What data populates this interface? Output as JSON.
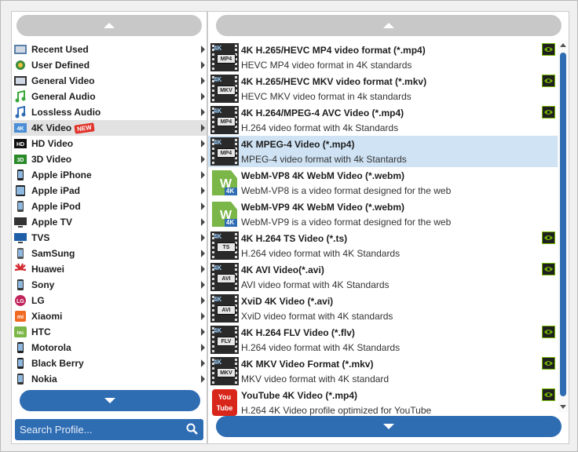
{
  "left_panel": {
    "categories": [
      {
        "label": "Recent Used",
        "icon": "recent-used-icon"
      },
      {
        "label": "User Defined",
        "icon": "user-defined-icon"
      },
      {
        "label": "General Video",
        "icon": "general-video-icon"
      },
      {
        "label": "General Audio",
        "icon": "general-audio-icon"
      },
      {
        "label": "Lossless Audio",
        "icon": "lossless-audio-icon"
      },
      {
        "label": "4K Video",
        "icon": "4k-video-icon",
        "badge": "NEW",
        "selected": true
      },
      {
        "label": "HD Video",
        "icon": "hd-video-icon"
      },
      {
        "label": "3D Video",
        "icon": "3d-video-icon"
      },
      {
        "label": "Apple iPhone",
        "icon": "iphone-icon"
      },
      {
        "label": "Apple iPad",
        "icon": "ipad-icon"
      },
      {
        "label": "Apple iPod",
        "icon": "ipod-icon"
      },
      {
        "label": "Apple TV",
        "icon": "apple-tv-icon"
      },
      {
        "label": "TVS",
        "icon": "tv-icon"
      },
      {
        "label": "SamSung",
        "icon": "samsung-icon"
      },
      {
        "label": "Huawei",
        "icon": "huawei-icon"
      },
      {
        "label": "Sony",
        "icon": "sony-icon"
      },
      {
        "label": "LG",
        "icon": "lg-icon"
      },
      {
        "label": "Xiaomi",
        "icon": "xiaomi-icon"
      },
      {
        "label": "HTC",
        "icon": "htc-icon"
      },
      {
        "label": "Motorola",
        "icon": "motorola-icon"
      },
      {
        "label": "Black Berry",
        "icon": "blackberry-icon"
      },
      {
        "label": "Nokia",
        "icon": "nokia-icon"
      }
    ],
    "search_placeholder": "Search Profile..."
  },
  "right_panel": {
    "formats": [
      {
        "title": "4K H.265/HEVC MP4 video format (*.mp4)",
        "desc": "HEVC MP4 video format in 4K standards",
        "tag": "MP4",
        "kind": "film",
        "cuda": true
      },
      {
        "title": "4K H.265/HEVC MKV video format (*.mkv)",
        "desc": "HEVC MKV video format in 4k standards",
        "tag": "MKV",
        "kind": "film",
        "cuda": true
      },
      {
        "title": "4K H.264/MPEG-4 AVC Video (*.mp4)",
        "desc": "H.264 video format with 4k Standards",
        "tag": "MP4",
        "kind": "film",
        "cuda": true
      },
      {
        "title": "4K MPEG-4 Video (*.mp4)",
        "desc": "MPEG-4 video format with 4k Stantards",
        "tag": "MP4",
        "kind": "film",
        "cuda": false,
        "selected": true
      },
      {
        "title": "WebM-VP8 4K WebM Video (*.webm)",
        "desc": "WebM-VP8 is a video format designed for the web",
        "tag": "4K",
        "kind": "webm",
        "cuda": false
      },
      {
        "title": "WebM-VP9 4K WebM Video (*.webm)",
        "desc": "WebM-VP9 is a video format designed for the web",
        "tag": "4K",
        "kind": "webm",
        "cuda": false
      },
      {
        "title": "4K H.264 TS Video (*.ts)",
        "desc": "H.264 video format with 4K Standards",
        "tag": "TS",
        "kind": "film",
        "cuda": true
      },
      {
        "title": "4K AVI Video(*.avi)",
        "desc": "AVI video format with 4K Standards",
        "tag": "AVI",
        "kind": "film",
        "cuda": true
      },
      {
        "title": "XviD 4K Video (*.avi)",
        "desc": "XviD video format with 4K standards",
        "tag": "AVI",
        "kind": "film",
        "cuda": false
      },
      {
        "title": "4K H.264 FLV Video (*.flv)",
        "desc": "H.264 video format with 4K Standards",
        "tag": "FLV",
        "kind": "film",
        "cuda": true
      },
      {
        "title": "4K MKV Video Format (*.mkv)",
        "desc": "MKV video format with 4K standard",
        "tag": "MKV",
        "kind": "film",
        "cuda": true
      },
      {
        "title": "YouTube 4K Video (*.mp4)",
        "desc": "H.264 4K Video profile optimized for YouTube",
        "tag": "You Tube",
        "kind": "youtube",
        "cuda": true
      }
    ]
  },
  "colors": {
    "accent": "#2f6db3",
    "selected_row": "#cfe3f4",
    "new_badge": "#e0332b"
  }
}
